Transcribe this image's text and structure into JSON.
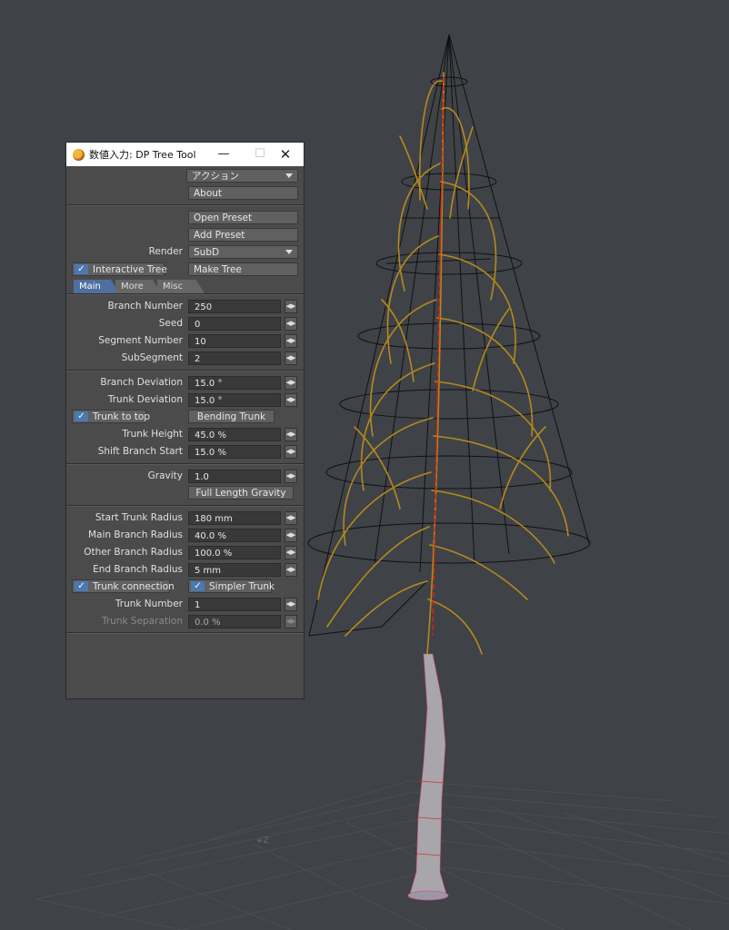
{
  "window": {
    "title": "数値入力: DP Tree Tool",
    "minimize": "—",
    "maximize": "☐",
    "close": "✕"
  },
  "top": {
    "action": "アクション",
    "about": "About"
  },
  "preset": {
    "open": "Open Preset",
    "add": "Add Preset",
    "render_label": "Render",
    "render_value": "SubD",
    "interactive_tree": "Interactive Tree",
    "make_tree": "Make Tree"
  },
  "tabs": [
    "Main",
    "More",
    "Misc"
  ],
  "branch": {
    "number_label": "Branch Number",
    "number": "250",
    "seed_label": "Seed",
    "seed": "0",
    "segment_label": "Segment Number",
    "segment": "10",
    "subsegment_label": "SubSegment",
    "subsegment": "2"
  },
  "deviation": {
    "branch_label": "Branch Deviation",
    "branch": "15.0 °",
    "trunk_label": "Trunk Deviation",
    "trunk": "15.0 °",
    "trunk_to_top": "Trunk to top",
    "bending_trunk": "Bending Trunk",
    "height_label": "Trunk Height",
    "height": "45.0 %",
    "shift_label": "Shift Branch Start",
    "shift": "15.0 %"
  },
  "gravity": {
    "label": "Gravity",
    "value": "1.0",
    "full_length": "Full Length Gravity"
  },
  "radius": {
    "start_label": "Start Trunk Radius",
    "start": "180 mm",
    "main_label": "Main Branch Radius",
    "main": "40.0 %",
    "other_label": "Other Branch Radius",
    "other": "100.0 %",
    "end_label": "End Branch Radius",
    "end": "5 mm",
    "trunk_connection": "Trunk connection",
    "simpler_trunk": "Simpler Trunk",
    "trunk_number_label": "Trunk Number",
    "trunk_number": "1",
    "separation_label": "Trunk Separation",
    "separation": "0.0 %"
  },
  "viewport": {
    "grid_label": "+Z"
  },
  "icons": {
    "spin": "◀▶",
    "check": "✓"
  }
}
